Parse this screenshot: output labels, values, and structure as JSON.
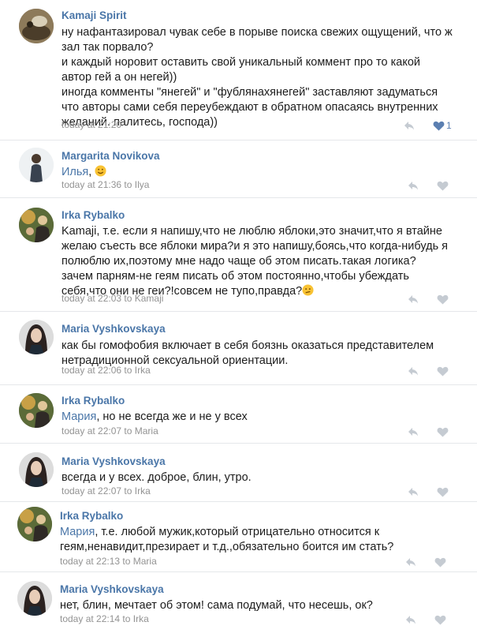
{
  "comments": [
    {
      "author": "Kamaji Spirit",
      "mention": "",
      "text": "ну нафантазировал чувак себе в порыве поиска свежих ощущений, что ж\nзал так порвало?\nи каждый норовит оставить свой уникальный коммент про то какой\nавтор гей а он негей))\nиногда комменты \"янегей\" и \"фублянахянегей\" заставляют задуматься\nчто авторы сами себя переубеждают в обратном опасаясь внутренних\nжеланий. палитесь, господа))",
      "meta": "today at 21:20",
      "likes": "1",
      "liked": true,
      "emoji": ""
    },
    {
      "author": "Margarita Novikova",
      "mention": "Илья",
      "text": ", ",
      "meta": "today at 21:36 to Ilya",
      "likes": "",
      "liked": false,
      "emoji": "smile"
    },
    {
      "author": "Irka Rybalko",
      "mention": "",
      "text": "Kamaji, т.е. если я напишу,что не люблю яблоки,это значит,что я втайне\nжелаю съесть все яблоки мира?и я это напишу,боясь,что когда-нибудь я\nполюблю их,поэтому мне надо чаще об этом писать.такая логика?\nзачем парням-не геям писать об этом постоянно,чтобы убеждать\nсебя,что они не геи?!совсем не тупо,правда?",
      "meta": "today at 22:03 to Kamaji",
      "likes": "",
      "liked": false,
      "emoji": "confused"
    },
    {
      "author": "Maria Vyshkovskaya",
      "mention": "",
      "text": "как бы гомофобия включает в себя боязнь оказаться представителем\nнетрадиционной сексуальной ориентации.",
      "meta": "today at 22:06 to Irka",
      "likes": "",
      "liked": false,
      "emoji": ""
    },
    {
      "author": "Irka Rybalko",
      "mention": "Мария",
      "text": ", но не всегда же и не у всех",
      "meta": "today at 22:07 to Maria",
      "likes": "",
      "liked": false,
      "emoji": ""
    },
    {
      "author": "Maria Vyshkovskaya",
      "mention": "",
      "text": "всегда и у всех. доброе, блин, утро.",
      "meta": "today at 22:07 to Irka",
      "likes": "",
      "liked": false,
      "emoji": ""
    },
    {
      "author": "Irka Rybalko",
      "mention": "Мария",
      "text": ", т.е. любой мужик,который отрицательно относится к\nгеям,ненавидит,презирает и т.д.,обязательно боится им стать?",
      "meta": "today at 22:13 to Maria",
      "likes": "",
      "liked": false,
      "emoji": ""
    },
    {
      "author": "Maria Vyshkovskaya",
      "mention": "",
      "text": "нет, блин, мечтает об этом! сама подумай, что несешь, ок?",
      "meta": "today at 22:14 to Irka",
      "likes": "",
      "liked": false,
      "emoji": ""
    }
  ],
  "icons": {
    "reply": "reply-arrow-icon",
    "like": "heart-icon"
  },
  "colors": {
    "author": "#4a76a8",
    "meta": "#939393",
    "liked": "#5b7fb1",
    "icon": "#c5cbd2"
  }
}
